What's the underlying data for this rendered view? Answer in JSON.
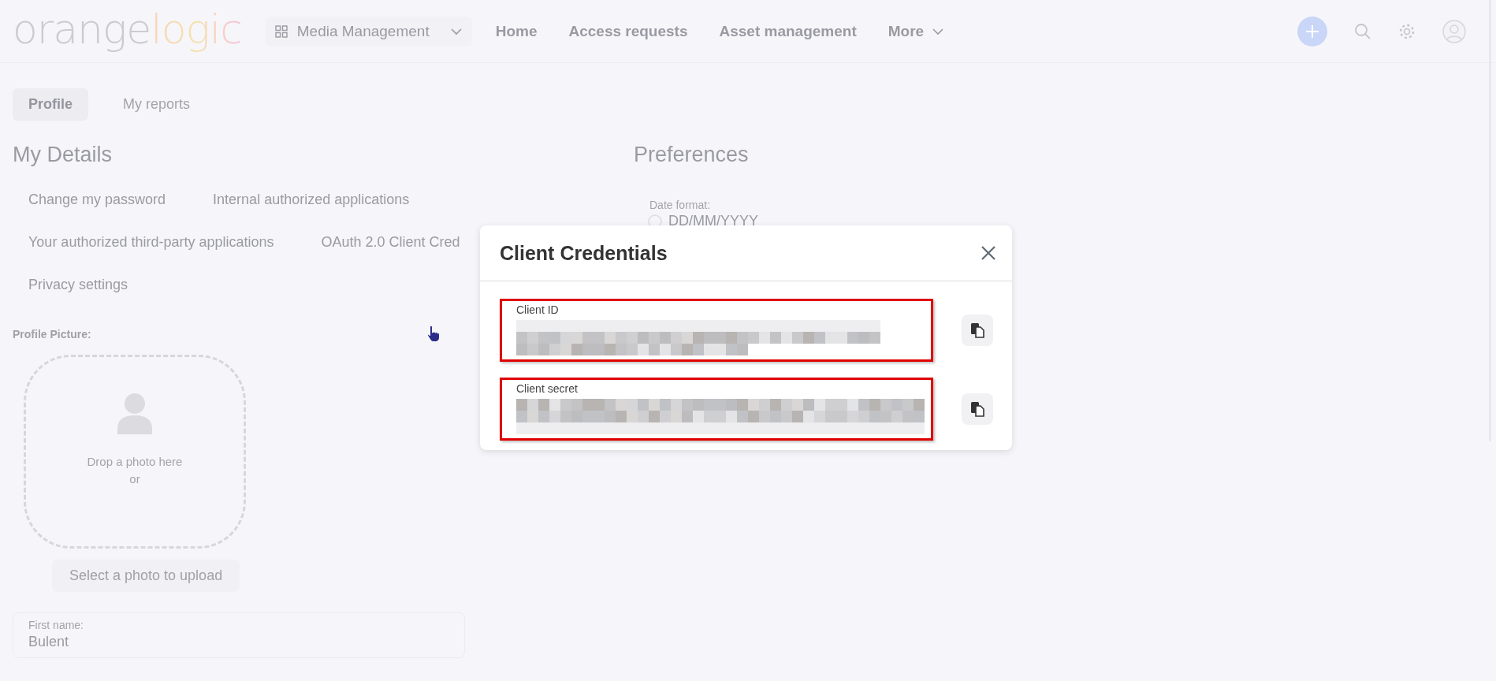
{
  "topbar": {
    "logo_parts": [
      "orange",
      "logic"
    ],
    "workspace": "Media Management",
    "nav": [
      {
        "label": "Home",
        "kind": "link"
      },
      {
        "label": "Access requests",
        "kind": "link"
      },
      {
        "label": "Asset management",
        "kind": "link"
      },
      {
        "label": "More",
        "kind": "menu"
      }
    ]
  },
  "tabs": [
    {
      "label": "Profile",
      "selected": true
    },
    {
      "label": "My reports",
      "selected": false
    }
  ],
  "my_details": {
    "title": "My Details",
    "links": [
      [
        "Change my password",
        "Internal authorized applications"
      ],
      [
        "Your authorized third-party applications",
        "OAuth 2.0 Client Cred"
      ],
      [
        "Privacy settings"
      ]
    ]
  },
  "profile_picture": {
    "label": "Profile Picture:",
    "drop_text": "Drop a photo here",
    "or_text": "or",
    "button": "Select a photo to upload"
  },
  "first_name": {
    "label": "First name:",
    "value": "Bulent"
  },
  "preferences": {
    "title": "Preferences",
    "date_format": {
      "label": "Date format:",
      "option": "DD/MM/YYYY",
      "selected": false
    }
  },
  "dialog": {
    "title": "Client Credentials",
    "fields": [
      {
        "label": "Client ID",
        "redacted": true,
        "highlighted": true
      },
      {
        "label": "Client secret",
        "redacted": true,
        "highlighted": true
      }
    ]
  }
}
